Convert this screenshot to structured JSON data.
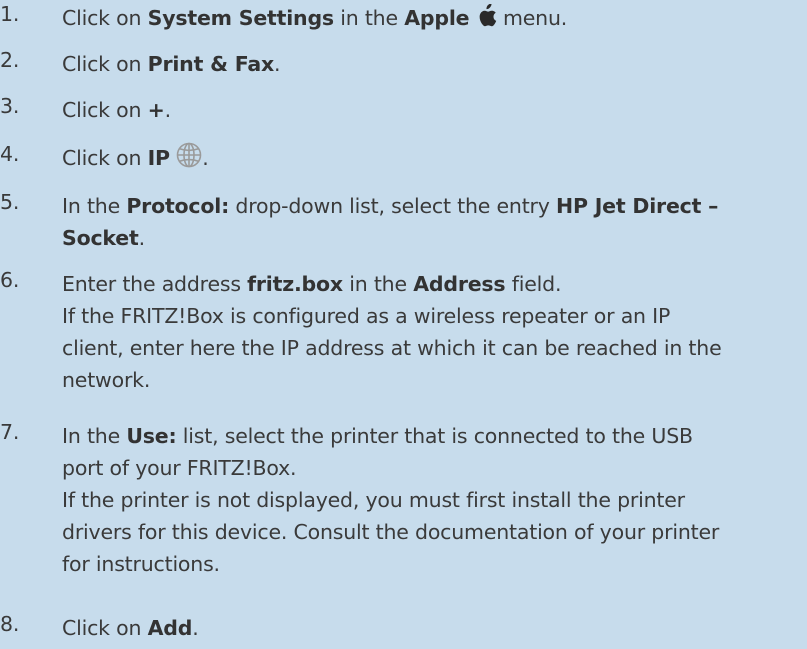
{
  "steps": [
    {
      "num": "1.",
      "parts": [
        "Click on ",
        "System Settings",
        " in the ",
        "Apple",
        " menu."
      ],
      "icon": "apple-logo-icon"
    },
    {
      "num": "2.",
      "parts": [
        "Click on ",
        "Print & Fax",
        "."
      ]
    },
    {
      "num": "3.",
      "parts": [
        "Click on ",
        "+",
        "."
      ]
    },
    {
      "num": "4.",
      "parts": [
        "Click on ",
        "IP",
        "."
      ],
      "icon": "globe-network-icon"
    },
    {
      "num": "5.",
      "line1": [
        "In the ",
        "Protocol:",
        " drop-down list, select the entry ",
        "HP Jet Direct –"
      ],
      "line2": [
        "Socket",
        "."
      ]
    },
    {
      "num": "6.",
      "line1": [
        "Enter the address ",
        "fritz.box",
        " in the ",
        "Address",
        " field."
      ],
      "note_lines": [
        "If the FRITZ!Box is configured as a wireless repeater or an IP",
        "client, enter here the IP address at which it can be reached in the",
        "network."
      ]
    },
    {
      "num": "7.",
      "line1": [
        "In the ",
        "Use:",
        " list, select the printer that is connected to the USB"
      ],
      "line2_text": "port of your FRITZ!Box.",
      "note_lines": [
        "If the printer is not displayed, you must first install the printer",
        "drivers for this device. Consult the documentation of your printer",
        "for instructions."
      ]
    },
    {
      "num": "8.",
      "parts": [
        "Click on ",
        "Add",
        "."
      ]
    }
  ]
}
